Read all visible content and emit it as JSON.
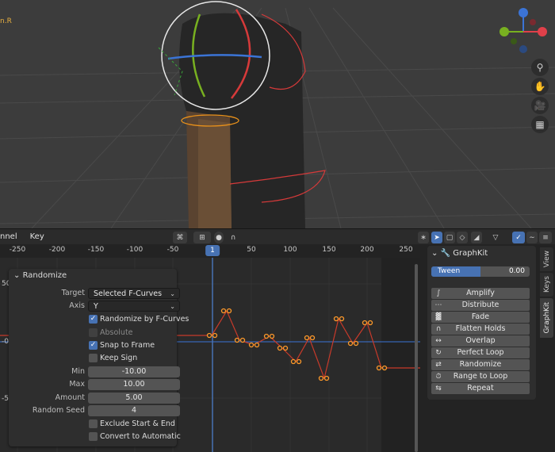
{
  "viewport": {
    "bone_label": "n.R",
    "nav_buttons": [
      "zoom-icon",
      "hand-icon",
      "camera-icon",
      "grid-icon"
    ],
    "gizmo": {
      "z_label": "Z",
      "y_label": "Y",
      "x_label": "X"
    }
  },
  "header": {
    "menus": [
      "nnel",
      "Key"
    ]
  },
  "scrubbar": {
    "ticks": [
      "-250",
      "-200",
      "-150",
      "-100",
      "-50",
      "50",
      "100",
      "150",
      "200",
      "250"
    ],
    "current_frame": "1"
  },
  "y_axis": {
    "top": "50",
    "zero": "-0",
    "bottom": "-5"
  },
  "operator": {
    "title": "Randomize",
    "target_label": "Target",
    "target_value": "Selected F-Curves",
    "axis_label": "Axis",
    "axis_value": "Y",
    "randomize_by_fcurves": "Randomize by F-Curves",
    "absolute": "Absolute",
    "snap_to_frame": "Snap to Frame",
    "keep_sign": "Keep Sign",
    "min_label": "Min",
    "min_value": "-10.00",
    "max_label": "Max",
    "max_value": "10.00",
    "amount_label": "Amount",
    "amount_value": "5.00",
    "seed_label": "Random Seed",
    "seed_value": "4",
    "exclude": "Exclude Start & End",
    "convert": "Convert to Automatic"
  },
  "graphkit": {
    "title": "GraphKit",
    "tween_label": "Tween",
    "tween_value": "0.00",
    "tween_fraction": 0.5,
    "buttons": [
      "Amplify",
      "Distribute",
      "Fade",
      "Flatten Holds",
      "Overlap",
      "Perfect Loop",
      "Randomize",
      "Range to Loop",
      "Repeat"
    ],
    "tabs": [
      "View",
      "Keys",
      "GraphKit"
    ]
  },
  "colors": {
    "accent": "#4772b3",
    "curve": "#e06a1b",
    "keyframe": "#ff9a2a",
    "x_axis": "#e0404a",
    "y_axis": "#78b020",
    "z_axis": "#3b74d6"
  }
}
